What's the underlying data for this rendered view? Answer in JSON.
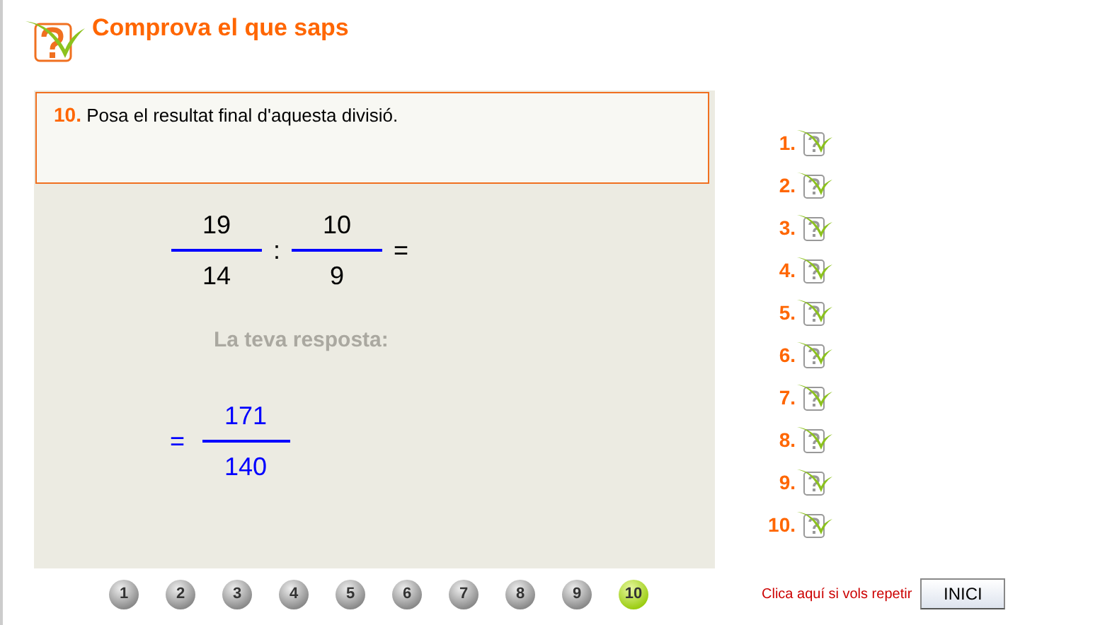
{
  "header": {
    "title": "Comprova el que saps"
  },
  "question": {
    "number": "10.",
    "text": "Posa el resultat final d'aquesta divisió."
  },
  "expression": {
    "fraction_1": {
      "numerator": "19",
      "denominator": "14"
    },
    "operator": ":",
    "fraction_2": {
      "numerator": "10",
      "denominator": "9"
    },
    "equals": "="
  },
  "answer": {
    "label": "La teva resposta:",
    "equals": "=",
    "numerator": "171",
    "denominator": "140"
  },
  "results": [
    {
      "number": "1."
    },
    {
      "number": "2."
    },
    {
      "number": "3."
    },
    {
      "number": "4."
    },
    {
      "number": "5."
    },
    {
      "number": "6."
    },
    {
      "number": "7."
    },
    {
      "number": "8."
    },
    {
      "number": "9."
    },
    {
      "number": "10."
    }
  ],
  "pages": [
    {
      "label": "1",
      "selected": false
    },
    {
      "label": "2",
      "selected": false
    },
    {
      "label": "3",
      "selected": false
    },
    {
      "label": "4",
      "selected": false
    },
    {
      "label": "5",
      "selected": false
    },
    {
      "label": "6",
      "selected": false
    },
    {
      "label": "7",
      "selected": false
    },
    {
      "label": "8",
      "selected": false
    },
    {
      "label": "9",
      "selected": false
    },
    {
      "label": "10",
      "selected": true
    }
  ],
  "footer": {
    "hint": "Clica aquí si vols repetir",
    "button": "INICI"
  }
}
